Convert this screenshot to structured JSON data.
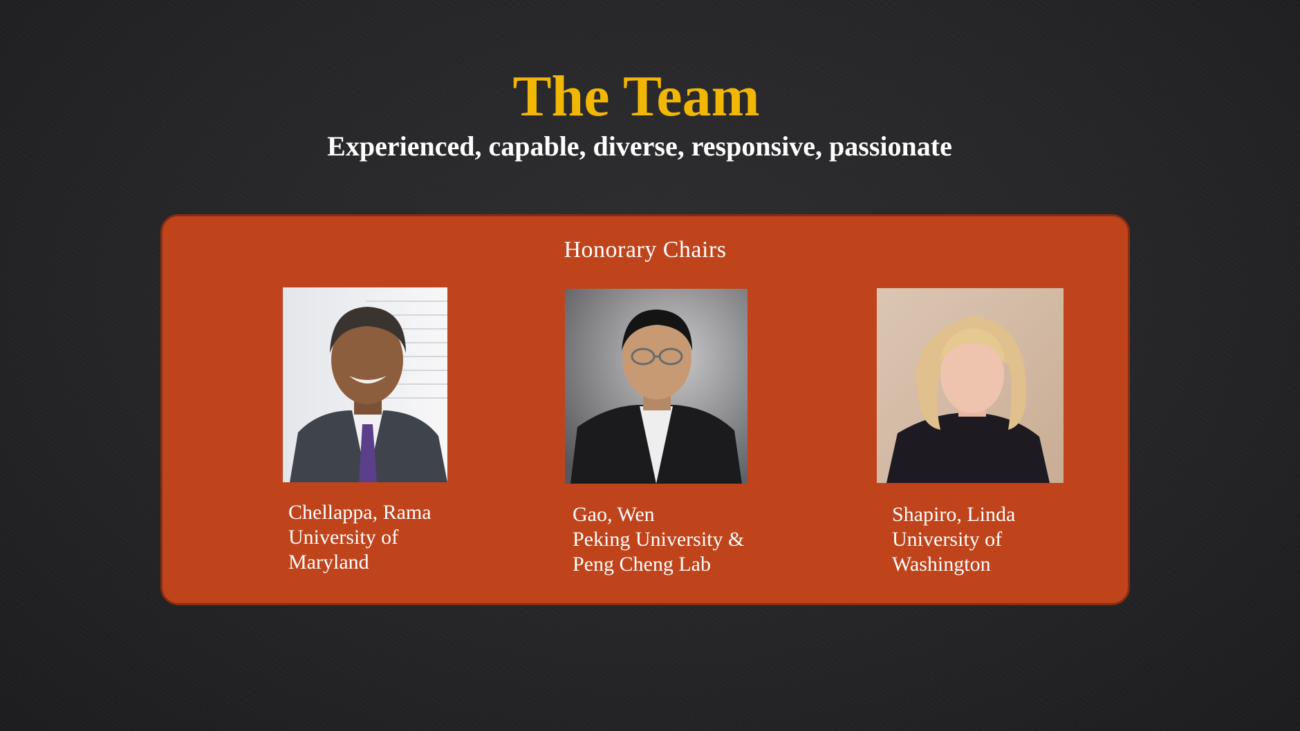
{
  "slide": {
    "title": "The Team",
    "subtitle": "Experienced, capable, diverse, responsive, passionate",
    "title_color": "#f2b705",
    "panel_color": "#bf441c"
  },
  "honorary_chairs": {
    "heading": "Honorary Chairs",
    "members": [
      {
        "name": "Chellappa, Rama",
        "affiliation_lines": [
          "University of",
          "Maryland"
        ]
      },
      {
        "name": "Gao, Wen",
        "affiliation_lines": [
          "Peking University &",
          "Peng Cheng Lab"
        ]
      },
      {
        "name": "Shapiro, Linda",
        "affiliation_lines": [
          "University of",
          "Washington"
        ]
      }
    ]
  }
}
